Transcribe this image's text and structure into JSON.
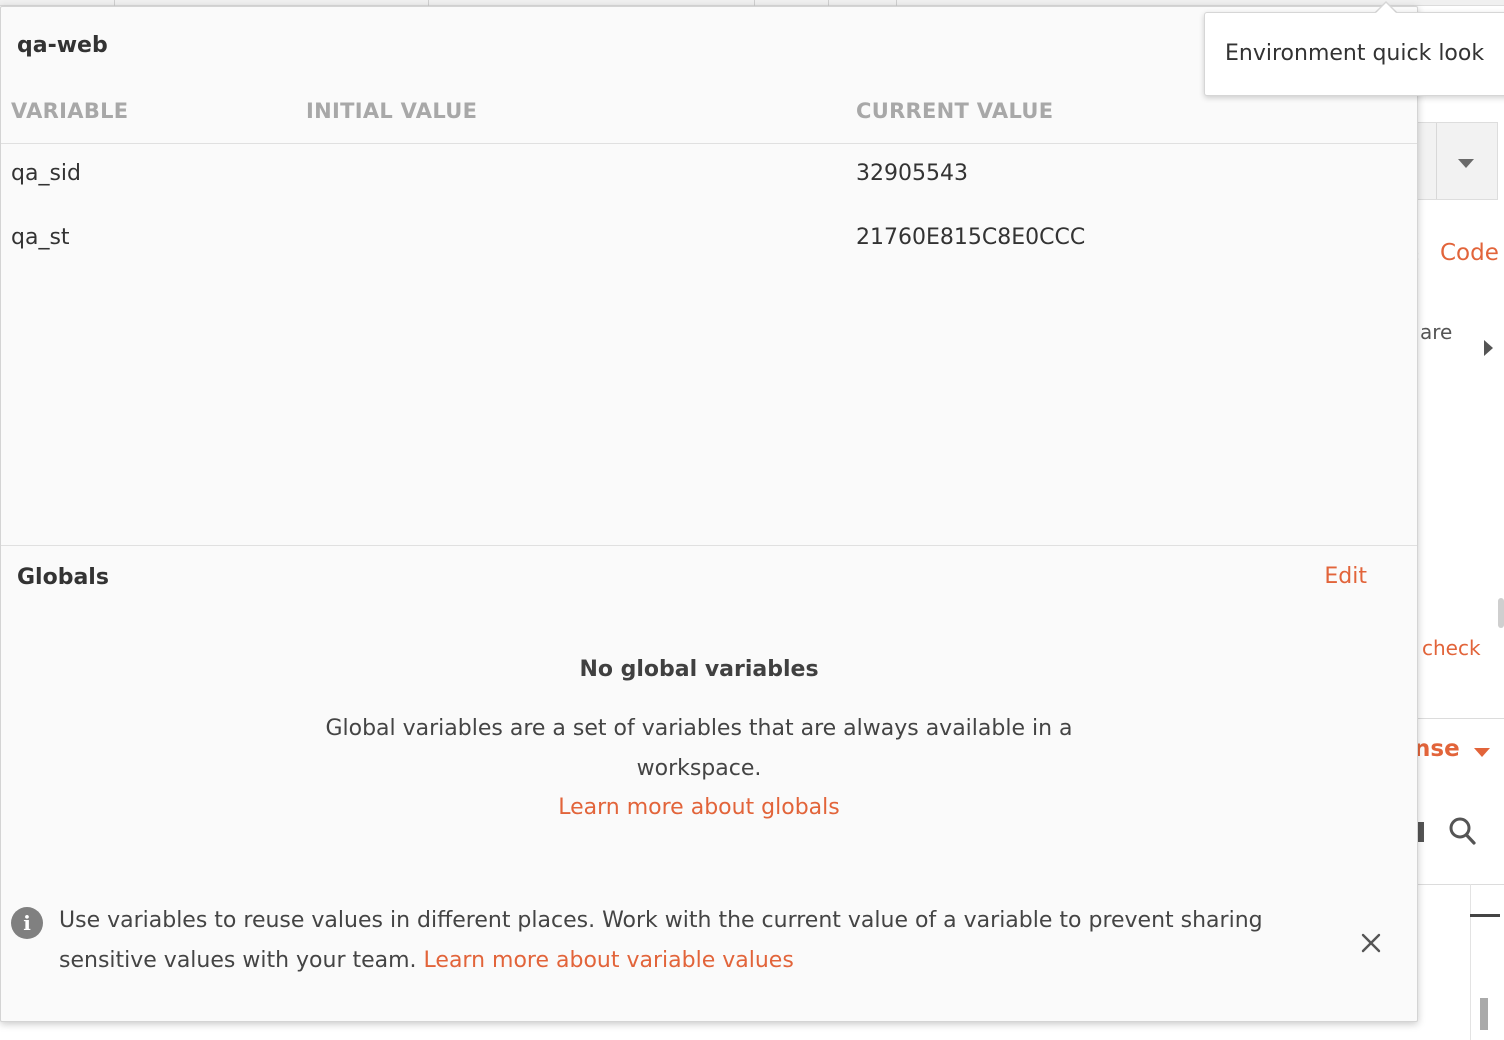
{
  "background": {
    "code_label": "Code",
    "partial_text_are": "are",
    "check_label": "check",
    "response_label": "nse"
  },
  "environment": {
    "name": "qa-web",
    "columns": {
      "variable": "VARIABLE",
      "initial_value": "INITIAL VALUE",
      "current_value": "CURRENT VALUE"
    },
    "variables": [
      {
        "name": "qa_sid",
        "initial_value": "",
        "current_value": "32905543"
      },
      {
        "name": "qa_st",
        "initial_value": "",
        "current_value": "21760E815C8E0CCC"
      }
    ]
  },
  "globals": {
    "title": "Globals",
    "edit_label": "Edit",
    "empty_title": "No global variables",
    "empty_description": "Global variables are a set of variables that are always available in a workspace.",
    "learn_more_label": "Learn more about globals"
  },
  "info": {
    "message": "Use variables to reuse values in different places. Work with the current value of a variable to prevent sharing sensitive values with your team.",
    "link_label": "Learn more about variable values"
  },
  "tooltip": {
    "text": "Environment quick look"
  },
  "colors": {
    "accent": "#e2643a",
    "header_text": "#a8a8a8",
    "panel_bg": "#fafafa"
  },
  "icons": {
    "info": "info-icon",
    "close": "close-icon",
    "search": "search-icon",
    "dropdown": "caret-down-icon"
  }
}
